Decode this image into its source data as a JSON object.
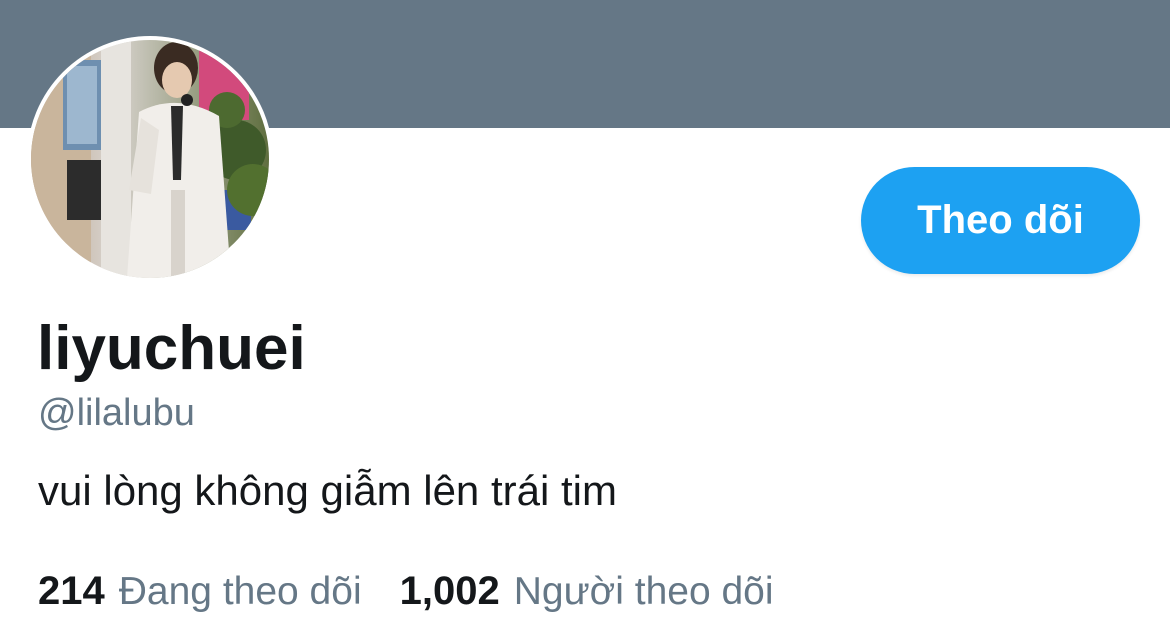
{
  "profile": {
    "display_name": "liyuchuei",
    "handle": "@lilalubu",
    "bio": "vui lòng không giẫm lên trái tim",
    "avatar_description": "profile-photo",
    "follow_label": "Theo dõi"
  },
  "stats": {
    "following_count": "214",
    "following_label": "Đang theo dõi",
    "followers_count": "1,002",
    "followers_label": "Người theo dõi"
  },
  "colors": {
    "banner": "#657786",
    "accent": "#1da1f2",
    "text_primary": "#14171a",
    "text_secondary": "#657786"
  }
}
